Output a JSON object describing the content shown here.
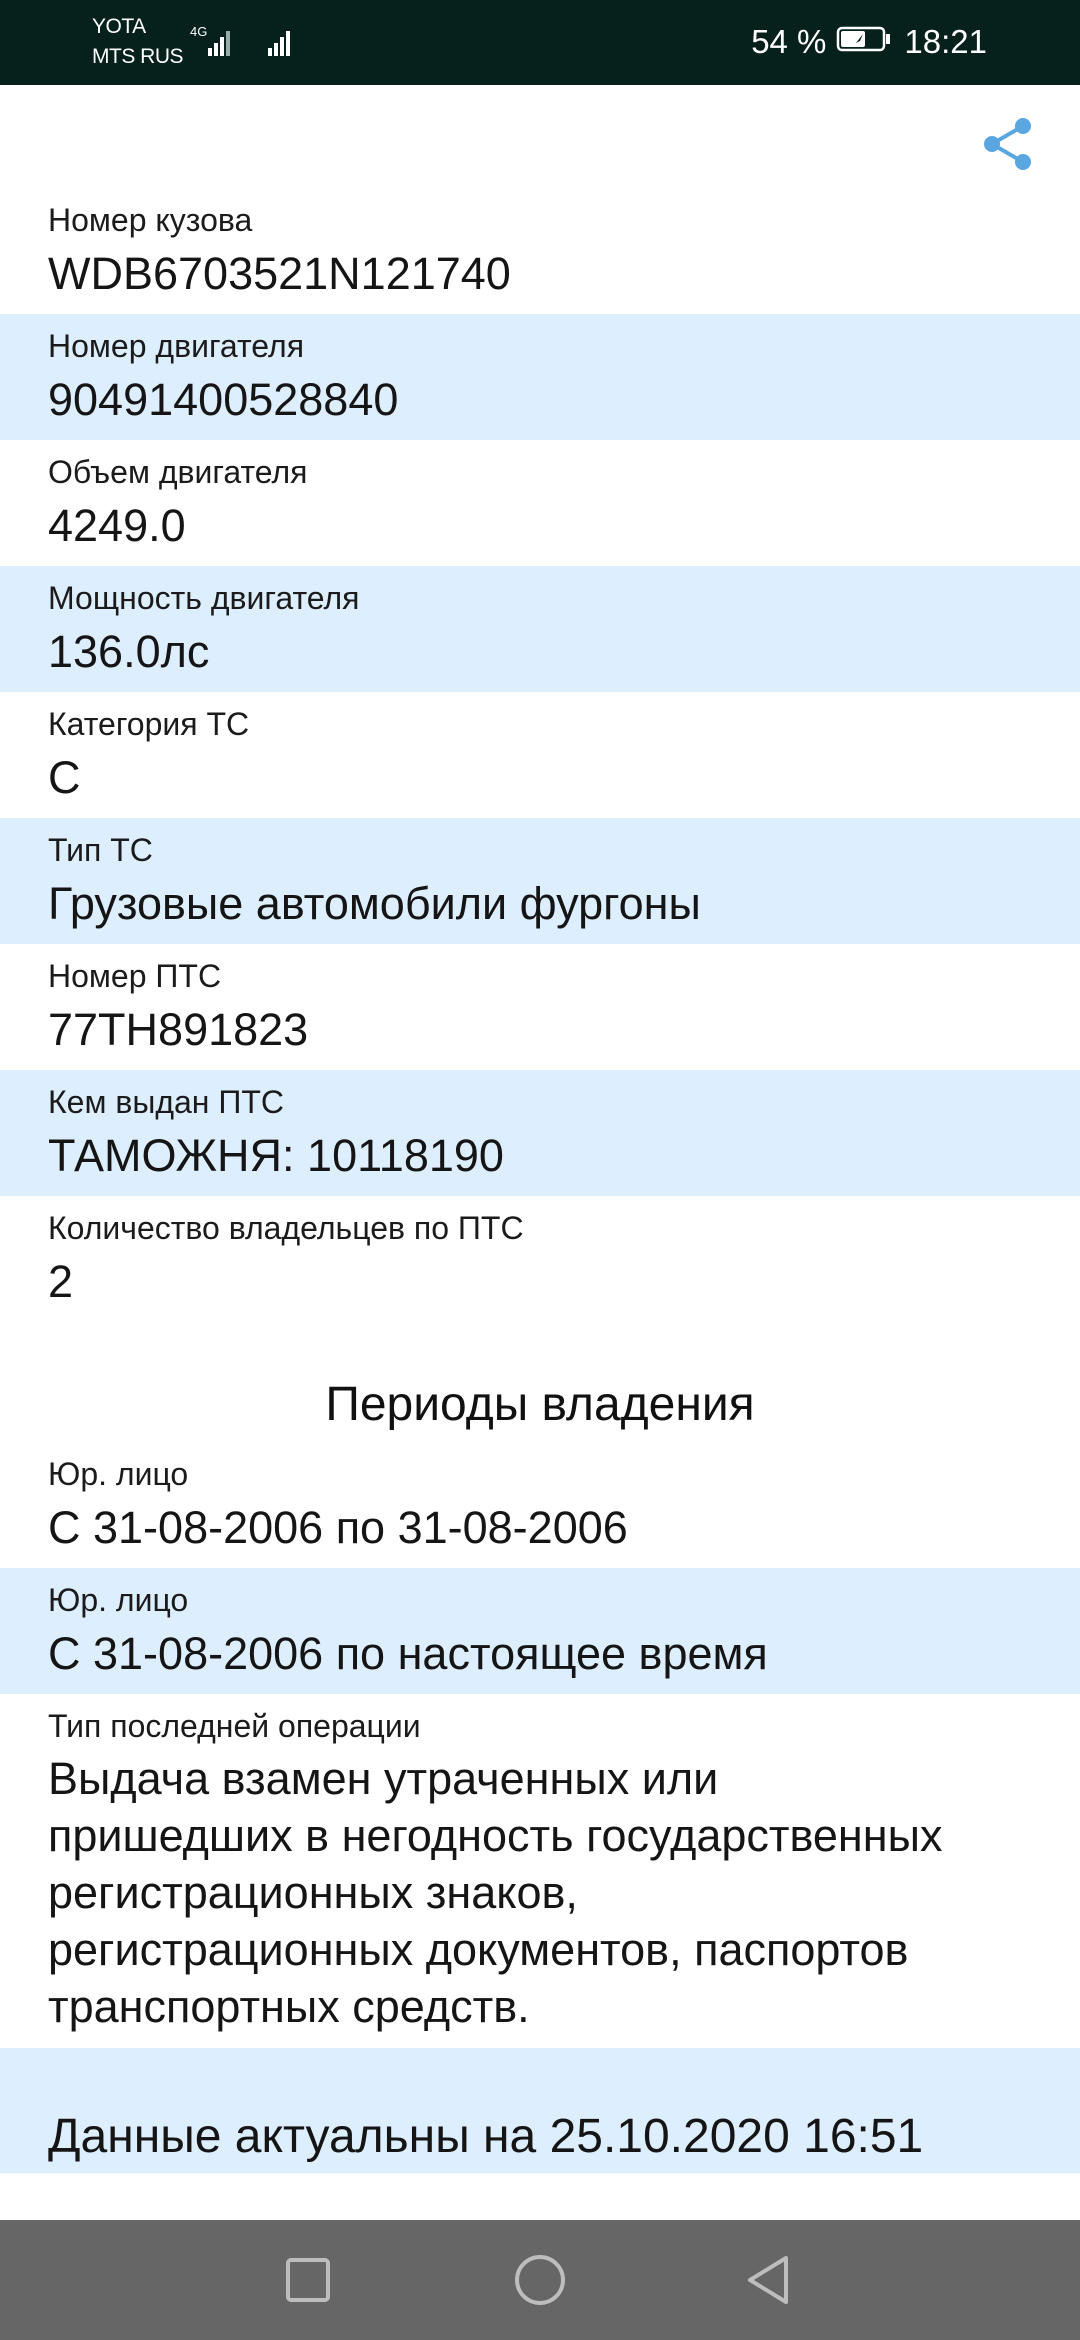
{
  "status_bar": {
    "carrier_1": "YOTA",
    "carrier_2": "MTS RUS",
    "network_type": "4G",
    "battery_percent": "54 %",
    "time": "18:21",
    "icons": [
      "signal-icon",
      "signal-icon",
      "battery-icon"
    ]
  },
  "toolbar": {
    "share_icon": "share-icon"
  },
  "fields": [
    {
      "label": "Номер кузова",
      "value": "WDB6703521N121740"
    },
    {
      "label": "Номер двигателя",
      "value": "90491400528840"
    },
    {
      "label": "Объем двигателя",
      "value": "4249.0"
    },
    {
      "label": "Мощность двигателя",
      "value": "136.0лс"
    },
    {
      "label": "Категория ТС",
      "value": "C"
    },
    {
      "label": "Тип ТС",
      "value": "Грузовые автомобили фургоны"
    },
    {
      "label": "Номер ПТС",
      "value": "77ТН891823"
    },
    {
      "label": "Кем выдан ПТС",
      "value": "ТАМОЖНЯ: 10118190"
    },
    {
      "label": "Количество владельцев по ПТС",
      "value": "2"
    }
  ],
  "ownership": {
    "title": "Периоды владения",
    "periods": [
      {
        "label": "Юр. лицо",
        "value": "С 31-08-2006 по 31-08-2006"
      },
      {
        "label": "Юр. лицо",
        "value": "С 31-08-2006 по настоящее время"
      }
    ]
  },
  "last_operation": {
    "label": "Тип последней операции",
    "lines": [
      "Выдача взамен утраченных или",
      "пришедших в негодность государственных",
      "регистрационных знаков,",
      "регистрационных документов, паспортов",
      "транспортных средств."
    ]
  },
  "actual_text": "Данные актуальны на 25.10.2020 16:51",
  "nav": {
    "icons": [
      "recent-apps-icon",
      "home-icon",
      "back-icon"
    ]
  },
  "colors": {
    "status_bar_bg": "#06201c",
    "row_alt_bg": "#ddeefe",
    "accent": "#5aa6e0",
    "nav_bg": "#666666"
  }
}
